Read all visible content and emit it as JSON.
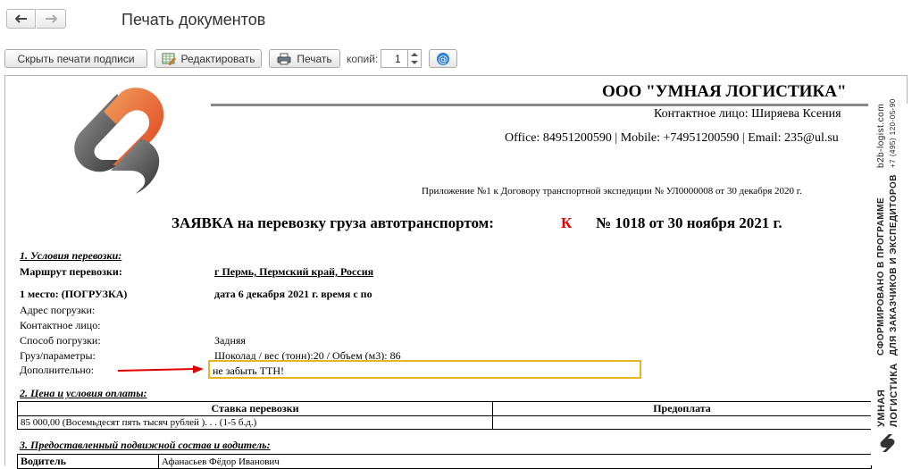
{
  "window": {
    "title": "Печать документов",
    "back_icon": "arrow-left-icon",
    "forward_icon": "arrow-right-icon"
  },
  "toolbar": {
    "hide_signatures_label": "Скрыть печати подписи",
    "edit_label": "Редактировать",
    "print_label": "Печать",
    "copies_label": "копий:",
    "copies_value": "1",
    "email_icon": "at-sign-icon"
  },
  "document": {
    "company": "ООО \"УМНАЯ ЛОГИСТИКА\"",
    "contact": "Контактное лицо: Ширяева Ксения",
    "office_line": "Office: 84951200590 | Mobile: +74951200590 | Email: 235@ul.su",
    "appendix": "Приложение №1 к Договору транспортной экспедиции № УЛ0000008 от 30 декабря 2020 г.",
    "request_title": "ЗАЯВКА на перевозку груза автотранспортом:",
    "request_mark": "К",
    "request_number": "№ 1018 от 30 ноября 2021 г.",
    "accent_red": "#e00000",
    "highlight_color": "#e8b422",
    "section1": {
      "title": "1. Условия перевозки:",
      "route_label": "Маршрут перевозки:",
      "route_value": "г Пермь,  Пермский край, Россия",
      "place_label": "1 место: (ПОГРУЗКА)",
      "place_value": "дата 6 декабря 2021 г.   время с  по",
      "address_label": "Адрес погрузки:",
      "contact_label": "Контактное лицо:",
      "method_label": "Способ погрузки:",
      "method_value": "Задняя",
      "cargo_label": "Груз/параметры:",
      "cargo_value": "Шоколад / вес (тонн):20 / Объем (м3): 86",
      "extra_label": "Дополнительно:",
      "extra_value": "не забыть ТТН!"
    },
    "section2": {
      "title": "2. Цена и условия оплаты:",
      "headers": [
        "Ставка перевозки",
        "Предоплата"
      ],
      "rows": [
        [
          "85 000,00 (Восемьдесят пять тысяч рублей ). . . (1-5 б.д.)",
          ""
        ]
      ]
    },
    "section3": {
      "title": "3. Предоставленный подвижной состав и водитель:",
      "driver_label": "Водитель",
      "driver_value": "Афанасьев Фёдор Иванович"
    }
  },
  "side_banner": {
    "site": "b2b-logist.com",
    "phone": "+7 (495) 120-05-90",
    "line1": "СФОРМИРОВАНО В ПРОГРАММЕ",
    "line2": "ДЛЯ ЗАКАЗЧИКОВ И ЭКСПЕДИТОРОВ",
    "brand1": "УМНАЯ",
    "brand2": "ЛОГИСТИКА"
  }
}
